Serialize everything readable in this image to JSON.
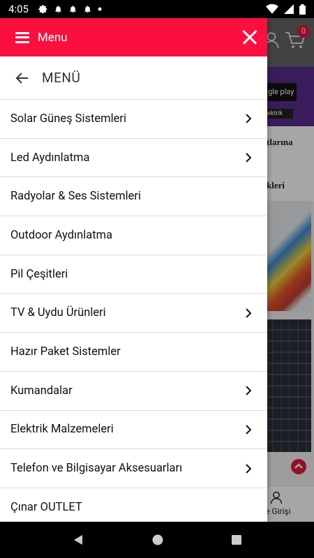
{
  "status_bar": {
    "time": "4:05"
  },
  "drawer": {
    "title": "Menu",
    "subheader": "MENÜ",
    "items": [
      {
        "label": "Solar Güneş Sistemleri",
        "has_children": true
      },
      {
        "label": "Led Aydınlatma",
        "has_children": true
      },
      {
        "label": "Radyolar & Ses Sistemleri",
        "has_children": false
      },
      {
        "label": "Outdoor Aydınlatma",
        "has_children": false
      },
      {
        "label": "Pil Çeşitleri",
        "has_children": false
      },
      {
        "label": "TV & Uydu Ürünleri",
        "has_children": true
      },
      {
        "label": "Hazır Paket Sistemler",
        "has_children": false
      },
      {
        "label": "Kumandalar",
        "has_children": true
      },
      {
        "label": "Elektrik Malzemeleri",
        "has_children": true
      },
      {
        "label": "Telefon ve Bilgisayar Aksesuarları",
        "has_children": true
      },
      {
        "label": "Çınar OUTLET",
        "has_children": false
      }
    ]
  },
  "background": {
    "cart_count": "0",
    "banner_store_text": "gle play",
    "banner_small_text": "ektrik",
    "heading_1": "tlarına",
    "heading_2": "kleri",
    "login_label": "e Girişi"
  },
  "colors": {
    "accent": "#fb0f3e",
    "divider": "#dcdcdc"
  }
}
